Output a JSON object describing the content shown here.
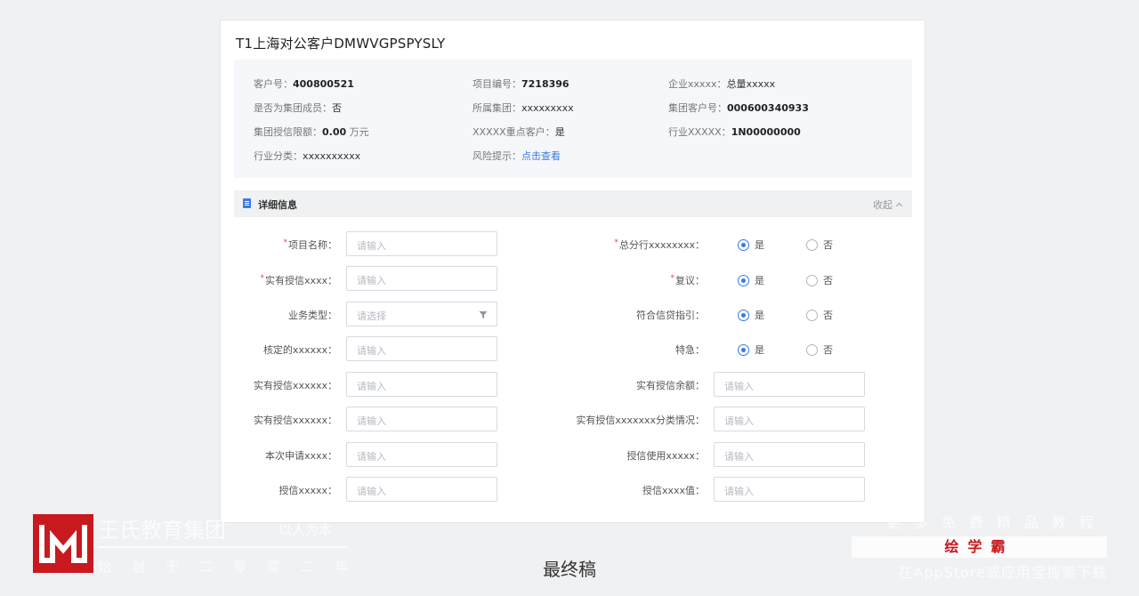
{
  "card": {
    "title": "T1上海对公客户DMWVGPSPYSLY"
  },
  "info": [
    {
      "label": "客户号：",
      "value": "400800521",
      "style": "strong"
    },
    {
      "label": "项目编号：",
      "value": "7218396",
      "style": "strong"
    },
    {
      "label": "企业xxxxx：",
      "value": "总量xxxxx",
      "style": "normal"
    },
    {
      "label": "是否为集团成员：",
      "value": "否",
      "style": "normal"
    },
    {
      "label": "所属集团：",
      "value": "xxxxxxxxx",
      "style": "normal"
    },
    {
      "label": "集团客户号：",
      "value": "000600340933",
      "style": "strong"
    },
    {
      "label": "集团授信限额：",
      "value": "0.00",
      "unit": "万元",
      "style": "strong"
    },
    {
      "label": "XXXXX重点客户：",
      "value": "是",
      "style": "normal"
    },
    {
      "label": "行业XXXXX：",
      "value": "1N00000000",
      "style": "strong"
    },
    {
      "label": "行业分类：",
      "value": "xxxxxxxxxx",
      "style": "normal"
    },
    {
      "label": "风险提示：",
      "value": "点击查看",
      "style": "link"
    }
  ],
  "section": {
    "title": "详细信息",
    "collapse_label": "收起"
  },
  "form_left": [
    {
      "label": "项目名称：",
      "required": true,
      "placeholder": "请输入",
      "type": "input"
    },
    {
      "label": "实有授信xxxx：",
      "required": true,
      "placeholder": "请输入",
      "type": "input"
    },
    {
      "label": "业务类型：",
      "required": false,
      "placeholder": "请选择",
      "type": "select"
    },
    {
      "label": "核定的xxxxxx：",
      "required": false,
      "placeholder": "请输入",
      "type": "input"
    },
    {
      "label": "实有授信xxxxxx：",
      "required": false,
      "placeholder": "请输入",
      "type": "input"
    },
    {
      "label": "实有授信xxxxxx：",
      "required": false,
      "placeholder": "请输入",
      "type": "input"
    },
    {
      "label": "本次申请xxxx：",
      "required": false,
      "placeholder": "请输入",
      "type": "input"
    },
    {
      "label": "授信xxxxx：",
      "required": false,
      "placeholder": "请输入",
      "type": "input"
    }
  ],
  "form_right_radios": [
    {
      "label": "总分行xxxxxxxx：",
      "required": true,
      "yes": "是",
      "no": "否",
      "selected": "yes"
    },
    {
      "label": "复议：",
      "required": true,
      "yes": "是",
      "no": "否",
      "selected": "yes"
    },
    {
      "label": "符合信贷指引：",
      "required": false,
      "yes": "是",
      "no": "否",
      "selected": "yes"
    },
    {
      "label": "特急：",
      "required": false,
      "yes": "是",
      "no": "否",
      "selected": "yes"
    }
  ],
  "form_right_inputs": [
    {
      "label": "实有授信余额：",
      "placeholder": "请输入"
    },
    {
      "label": "实有授信xxxxxxx分类情况：",
      "placeholder": "请输入"
    },
    {
      "label": "授信使用xxxxx：",
      "placeholder": "请输入"
    },
    {
      "label": "授信xxxx值：",
      "placeholder": "请输入"
    }
  ],
  "required_mark": "*",
  "watermark": {
    "company": "王氏教育集团",
    "slogan": "以人为本",
    "founded": "始创于二零零二年",
    "right_top": "更多免费精品教程",
    "badge": "绘学霸",
    "right_bottom": "在AppStore或应用宝搜索下载"
  },
  "caption": "最终稿",
  "colors": {
    "accent": "#3a7be0",
    "required": "#e54545",
    "logo": "#c8191e"
  }
}
